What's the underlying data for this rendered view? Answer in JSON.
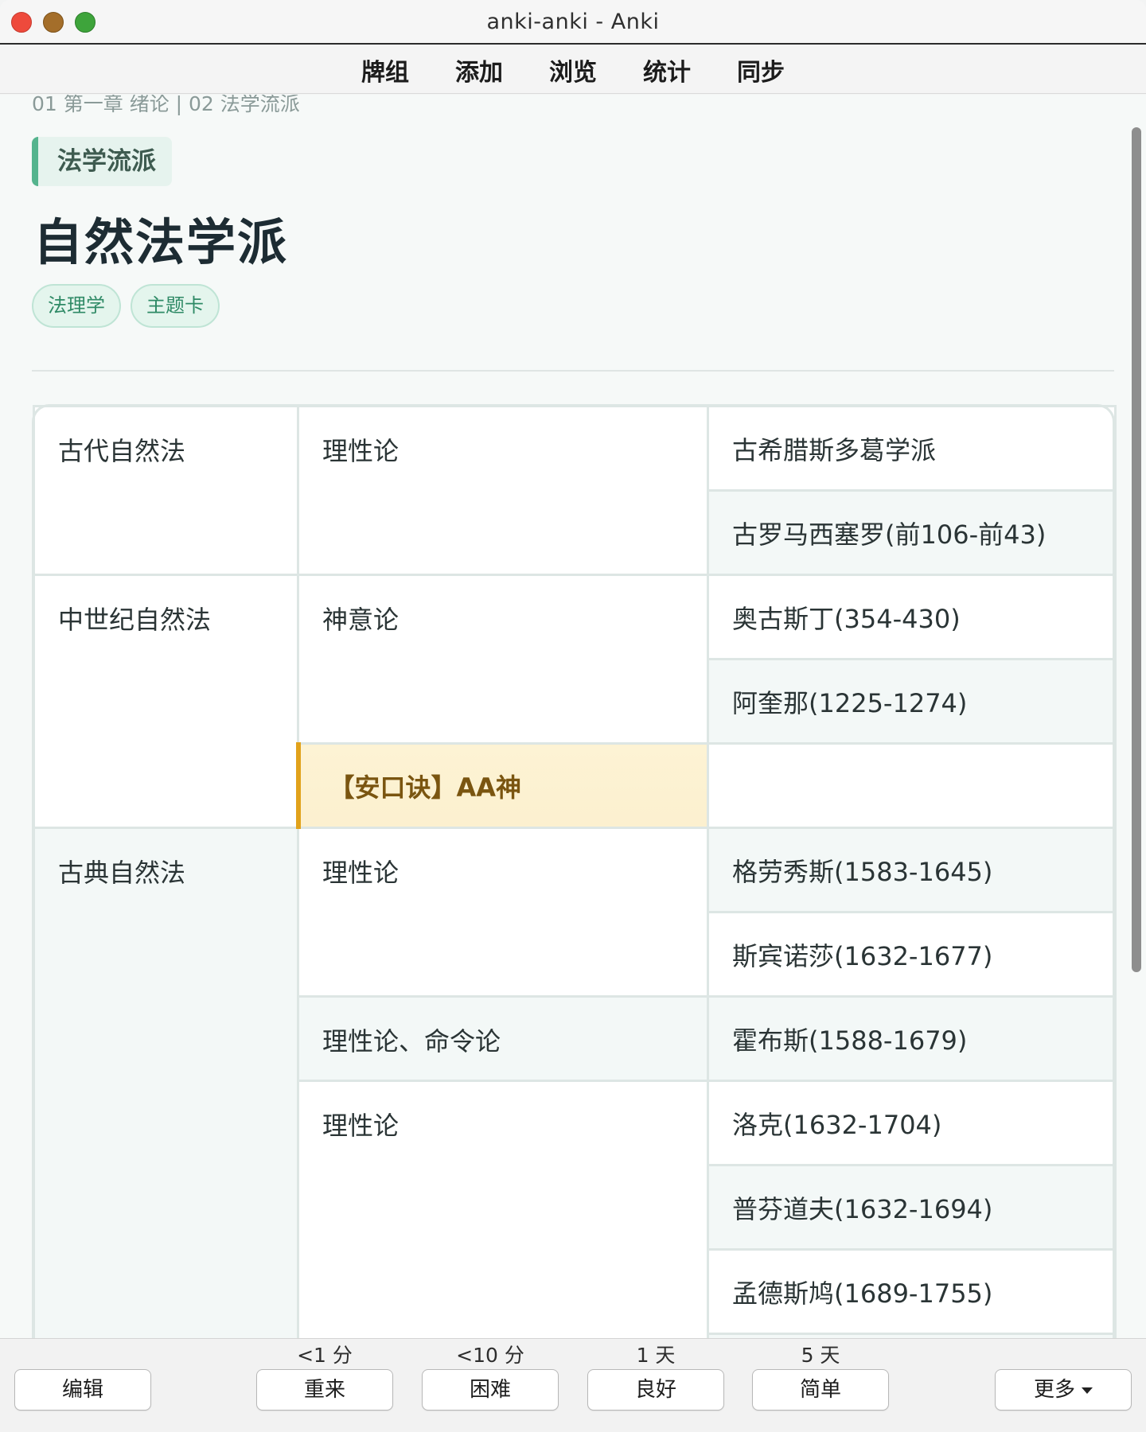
{
  "window": {
    "title": "anki-anki - Anki"
  },
  "nav": {
    "items": [
      "牌组",
      "添加",
      "浏览",
      "统计",
      "同步"
    ]
  },
  "card": {
    "breadcrumb": "01 第一章 绪论 | 02 法学流派",
    "topic": "法学流派",
    "title": "自然法学派",
    "tags": [
      "法理学",
      "主题卡"
    ],
    "table": {
      "r1": {
        "era": "古代自然法",
        "theory": "理性论",
        "person": "古希腊斯多葛学派"
      },
      "r2": {
        "person": "古罗马西塞罗(前106-前43)"
      },
      "r3": {
        "era": "中世纪自然法",
        "theory": "神意论",
        "person": "奥古斯丁(354-430)"
      },
      "r4": {
        "person": "阿奎那(1225-1274)"
      },
      "r5": {
        "mnemonic": "【安口诀】AA神",
        "person": ""
      },
      "r6": {
        "era": "古典自然法",
        "theory": "理性论",
        "person": "格劳秀斯(1583-1645)"
      },
      "r7": {
        "person": "斯宾诺莎(1632-1677)"
      },
      "r8": {
        "theory": "理性论、命令论",
        "person": "霍布斯(1588-1679)"
      },
      "r9": {
        "theory": "理性论",
        "person": "洛克(1632-1704)"
      },
      "r10": {
        "person": "普芬道夫(1632-1694)"
      },
      "r11": {
        "person": "孟德斯鸠(1689-1755)"
      }
    }
  },
  "answer_bar": {
    "edit": "编辑",
    "again": {
      "label": "重来",
      "interval": "<1 分"
    },
    "hard": {
      "label": "困难",
      "interval": "<10 分"
    },
    "good": {
      "label": "良好",
      "interval": "1 天"
    },
    "easy": {
      "label": "简单",
      "interval": "5 天"
    },
    "more": "更多"
  },
  "colors": {
    "accent_green": "#55b48e",
    "tag_green": "#2f8a66",
    "mnemonic_gold": "#e1a21b",
    "mnemonic_bg": "#fdf3d4"
  }
}
